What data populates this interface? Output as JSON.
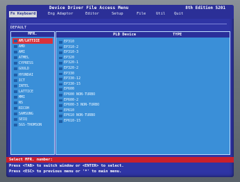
{
  "app_title": "Device Driver File Access Menu",
  "edition": "8th Edition 5201",
  "menu": [
    "Fn Keyboard",
    "Eng Adaptor",
    "Editor",
    "Setup",
    "File",
    "Util",
    "Quit"
  ],
  "default_label": "DEFAULT",
  "mfr_header": "MFR.",
  "manufacturers": [
    "AM/LATTICE",
    "AMD",
    "AMI",
    "ATMEL",
    "CYPRESS",
    "GOULD",
    "HYUNDAI",
    "ICT",
    "INTEL",
    "LATTICE",
    "MMI",
    "NS",
    "RICOH",
    "SAMSUNG",
    "SEIQ",
    "SGS-THOMSON"
  ],
  "selected_index": 0,
  "device_header": {
    "pld": "PLD Device",
    "type": "TYPE"
  },
  "devices": [
    "EP310",
    "EP310-2",
    "EP310-3",
    "EP320",
    "EP320-1",
    "EP320-2",
    "EP330",
    "EP330-12",
    "EP330-15",
    "EP600",
    "EP600 NON-TURBO",
    "EP600-2",
    "EP600-3 NON-TURBO",
    "EP610",
    "EP610 NON-TURBO",
    "EP610-15"
  ],
  "prompt": "Select MFR. number:",
  "help_lines": [
    "Press <TAB> to switch window or <ENTER> to select.",
    "Press <ESC> to previous menu or '*' to main menu."
  ]
}
